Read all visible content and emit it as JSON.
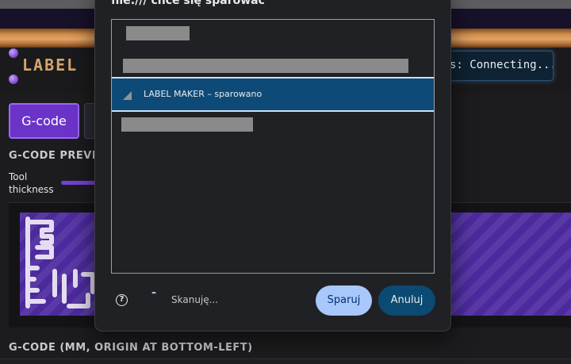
{
  "app": {
    "logo": "LABEL",
    "status": "s: Connecting...",
    "tabs": {
      "gcode": "G-code"
    },
    "preview_title": "G-CODE PREVIE",
    "tool_thickness_label": "Tool\nthickness",
    "gcode_section_title": "G-CODE (MM, ORIGIN AT BOTTOM-LEFT)"
  },
  "dialog": {
    "title": "file:/// chce się sparować",
    "devices": [
      {
        "name": "",
        "redacted": true,
        "selected": false
      },
      {
        "name": "",
        "redacted": true,
        "selected": false
      },
      {
        "name": "LABEL MAKER – sparowano",
        "redacted": false,
        "selected": true,
        "icon": "signal-strength-icon"
      },
      {
        "name": "",
        "redacted": true,
        "selected": false
      }
    ],
    "help_glyph": "?",
    "scanning_label": "Skanuję...",
    "pair_label": "Sparuj",
    "cancel_label": "Anuluj"
  },
  "colors": {
    "accent_purple": "#6c33c9",
    "dialog_selected": "#0e4a77",
    "pair_button": "#a8c7fa",
    "cancel_button": "#0b4a72"
  }
}
